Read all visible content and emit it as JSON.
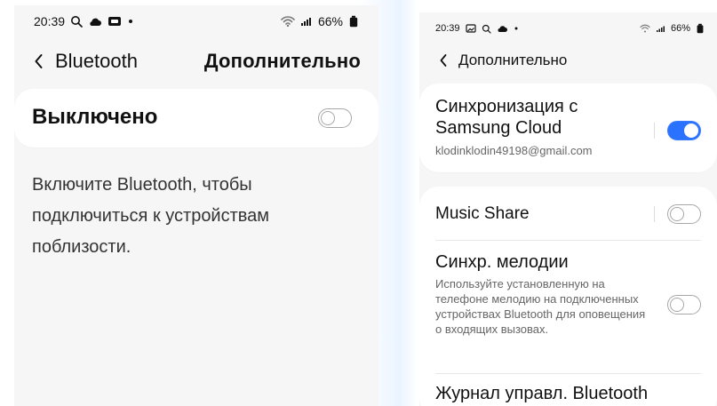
{
  "left_screen": {
    "status_bar": {
      "time": "20:39",
      "battery": "66%"
    },
    "nav": {
      "back_label": "Bluetooth",
      "more_label": "Дополнительно"
    },
    "main_toggle": {
      "label": "Выключено",
      "state": "off"
    },
    "help_text": "Включите Bluetooth, чтобы подключиться к устройствам поблизости."
  },
  "right_screen": {
    "status_bar": {
      "time": "20:39",
      "battery": "66%"
    },
    "nav": {
      "back_label": "Дополнительно"
    },
    "items": [
      {
        "title": "Синхронизация с Samsung Cloud",
        "subtitle": "klodinklodin49198@gmail.com",
        "toggle": "on"
      },
      {
        "title": "Music Share",
        "subtitle": "",
        "toggle": "off"
      },
      {
        "title": "Синхр. мелодии",
        "subtitle": "Используйте установленную на телефоне мелодию на подключенных устройствах Bluetooth для оповещения о входящих вызовах.",
        "toggle": "off"
      },
      {
        "title": "Журнал управл. Bluetooth",
        "subtitle": "",
        "toggle": ""
      }
    ]
  },
  "colors": {
    "accent": "#2b73ff",
    "background": "#f6f6f6",
    "card": "#ffffff"
  },
  "icons": [
    "search-icon",
    "cloud-icon",
    "screen-icon",
    "dot-icon",
    "gallery-icon",
    "wifi-icon",
    "signal-icon",
    "battery-icon",
    "back-chevron-icon"
  ]
}
